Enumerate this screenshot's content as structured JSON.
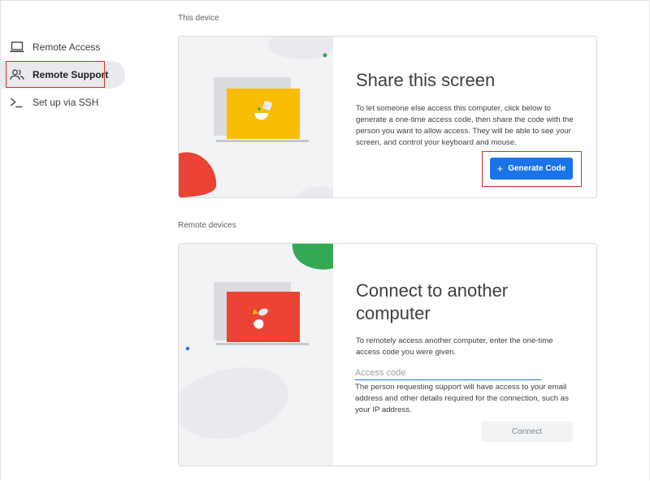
{
  "sidebar": {
    "items": [
      {
        "label": "Remote Access",
        "icon": "laptop-icon"
      },
      {
        "label": "Remote Support",
        "icon": "people-icon",
        "active": true
      },
      {
        "label": "Set up via SSH",
        "icon": "terminal-icon"
      }
    ]
  },
  "this_device": {
    "section_title": "This device",
    "heading": "Share this screen",
    "description": "To let someone else access this computer, click below to generate a one-time access code, then share the code with the person you want to allow access. They will be able to see your screen, and control your keyboard and mouse.",
    "generate_button": "Generate Code"
  },
  "remote_devices": {
    "section_title": "Remote devices",
    "heading_line1": "Connect to another",
    "heading_line2": "computer",
    "description": "To remotely access another computer, enter the one-time access code you were given.",
    "access_code_placeholder": "Access code",
    "access_code_value": "",
    "note": "The person requesting support will have access to your email address and other details required for the connection, such as your IP address.",
    "connect_button": "Connect"
  },
  "colors": {
    "accent": "#1a73e8",
    "highlight": "#d93025",
    "yellow": "#fbbc04",
    "red": "#ea4335",
    "green": "#34a853"
  }
}
